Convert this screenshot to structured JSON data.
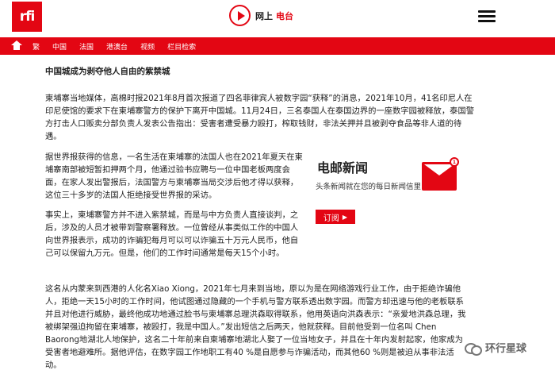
{
  "header": {
    "logo": "rfi",
    "radio_label_1": "网上",
    "radio_label_2": "电台"
  },
  "nav": {
    "items": [
      "繁",
      "中国",
      "法国",
      "港澳台",
      "视频",
      "栏目检索"
    ]
  },
  "article": {
    "title": "中国城成为剥夺他人自由的紫禁城",
    "paragraphs": [
      "柬埔寨当地媒体，高棉时报2021年8月首次报道了四名菲律宾人被数字园“获释”的消息，2021年10月，41名印尼人在印尼使馆的要求下在柬埔寨警方的保护下离开中国城。11月24日，三名泰国人在泰国边界的一座数字园被释放，泰国警方打击人口贩卖分部负责人发表公告指出：受害者遭受暴力殴打，榨取钱财，非法关押并且被剥夺食品等非人道的待遇。",
      "据世界报获得的信息，一名生活在柬埔寨的法国人也在2021年夏天在柬埔寨南部被短暂扣押两个月，他通过验书应聘与一位中国老板两度会面，在家人发出警报后，法国警方与柬埔寨当局交涉后他才得以获释，这位三十多岁的法国人拒绝接受世界报的采访。",
      "事实上，柬埔寨警方并不进入紫禁城，而是与中方负责人直接谈判，之后，涉及的人员才被带到警察署释放。一位曾经从事类似工作的中国人向世界报表示，成功的诈骗犯每月可以可以诈骗五十万元人民币，他自己可以保留九万元。但是，他们的工作时间通常是每天15个小时。",
      "这名从内蒙来到西港的人化名Xiao Xiong，2021年七月来到当地，原以为是在网络游戏行业工作，由于拒绝诈骗他人，拒绝一天15小时的工作时间，他试图通过隐藏的一个手机与警方联系透出数字园。而警方却迅速与他的老板联系并且对他进行威胁，最终他成功地通过脸书与柬埔寨总理洪森取得联系，他用英语向洪森表示：“亲爱地洪森总理，我被绑架强迫拘留在柬埔寨，被殴打，我是中国人。”发出短信之后两天，他就获释。目前他受到一位名叫 Chen Baorong地湖北人地保护，这名二十年前来自柬埔寨地湖北人娶了一位当地女子，并且在十年内发射起家，他家成为受害者地避难所。据他评估，在数字园工作地职工有40 %是自愿参与诈骗活动，而其他60 %则是被迫从事非法活动。"
    ]
  },
  "newsletter": {
    "title": "电邮新闻",
    "description": "头条新闻就在您的每日新闻信里",
    "button_label": "订阅",
    "button_arrow": "▶",
    "badge_count": "1"
  },
  "watermark": {
    "text": "环行星球"
  },
  "colors": {
    "brand_red": "#e30613"
  }
}
